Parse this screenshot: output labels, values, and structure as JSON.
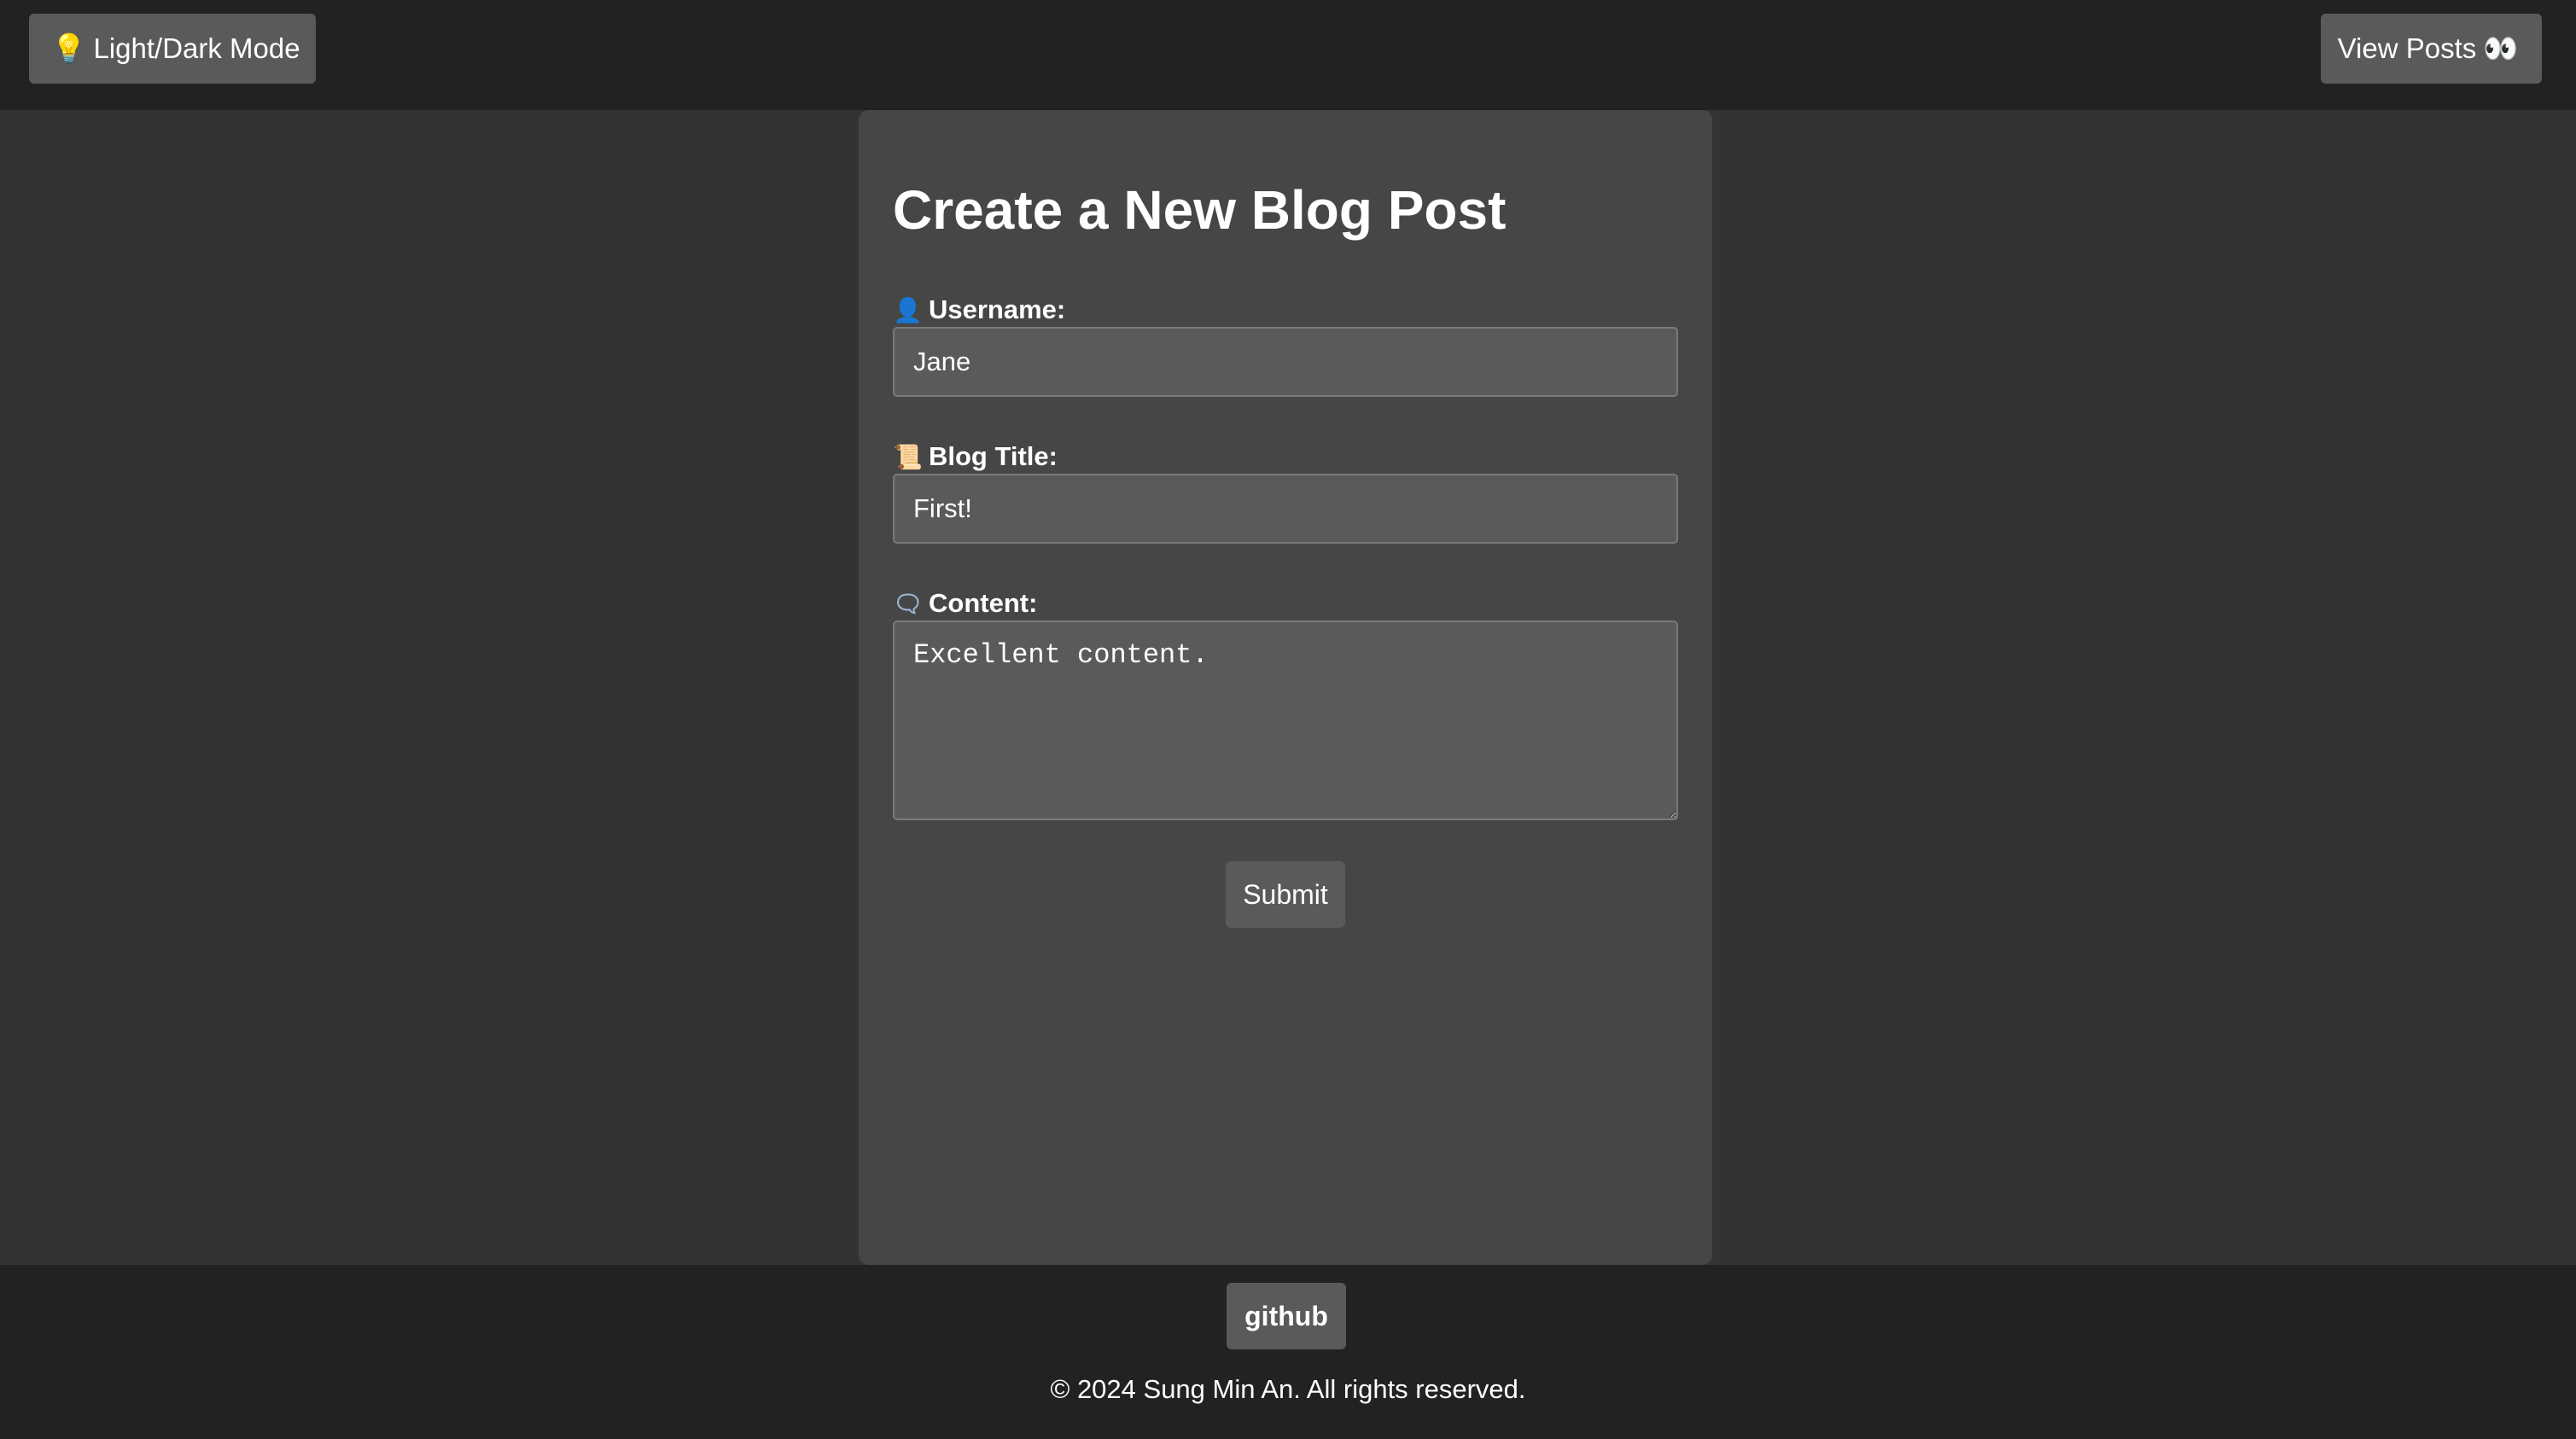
{
  "header": {
    "mode_toggle": {
      "icon": "lightbulb-icon",
      "label": "Light/Dark Mode"
    },
    "view_posts": {
      "label": "View Posts",
      "icon": "eyes-icon"
    }
  },
  "form": {
    "title": "Create a New Blog Post",
    "username": {
      "icon": "user-icon",
      "label": "Username:",
      "value": "Jane"
    },
    "blog_title": {
      "icon": "scroll-icon",
      "label": "Blog Title:",
      "value": "First!"
    },
    "content": {
      "icon": "speech-bubble-icon",
      "label": "Content:",
      "value": "Excellent content."
    },
    "submit_label": "Submit"
  },
  "footer": {
    "github_label": "github",
    "copyright": "© 2024 Sung Min An. All rights reserved."
  },
  "colors": {
    "page_bg": "#333333",
    "bar_bg": "#222222",
    "card_bg": "#464646",
    "button_bg": "#5a5a5a",
    "input_bg": "#5a5a5a",
    "text": "#ffffff"
  }
}
